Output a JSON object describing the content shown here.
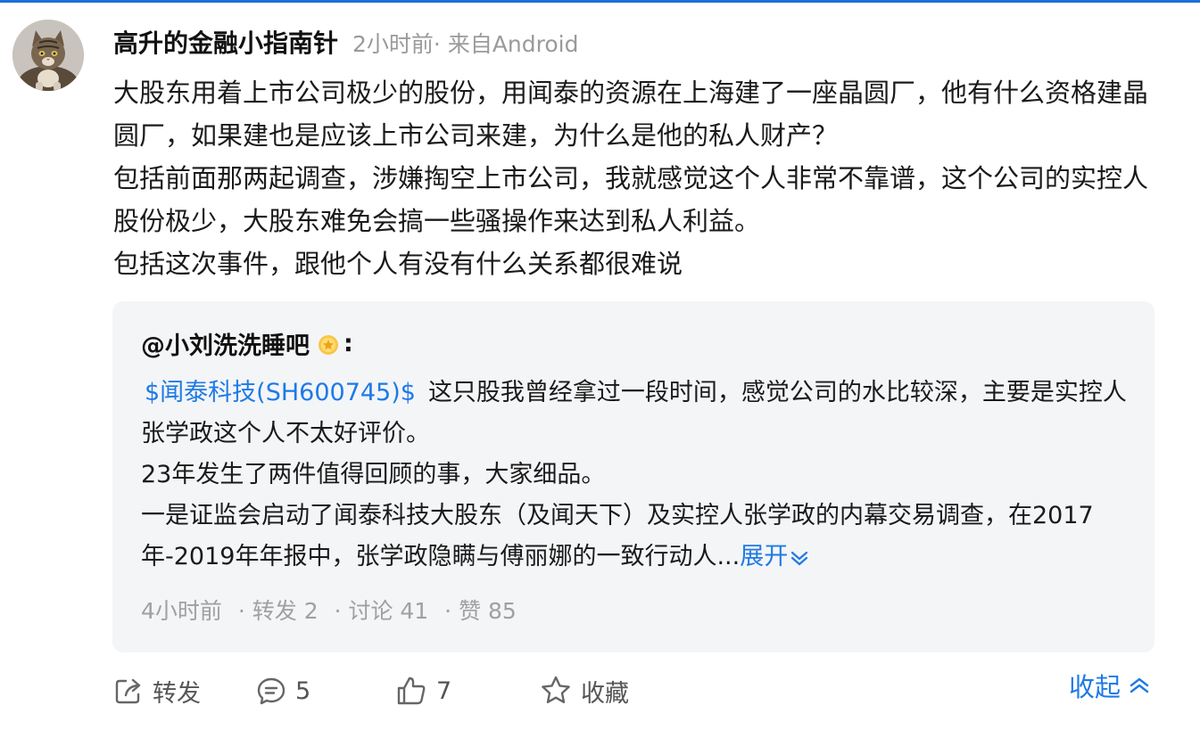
{
  "colors": {
    "accent": "#1e7ae6",
    "text": "#1a1a1a",
    "muted": "#9a9a9a",
    "card_bg": "#f4f5f7"
  },
  "post": {
    "author": "高升的金融小指南针",
    "meta": "2小时前· 来自Android",
    "paragraphs": [
      "大股东用着上市公司极少的股份，用闻泰的资源在上海建了一座晶圆厂，他有什么资格建晶圆厂，如果建也是应该上市公司来建，为什么是他的私人财产？",
      "包括前面那两起调查，涉嫌掏空上市公司，我就感觉这个人非常不靠谱，这个公司的实控人股份极少，大股东难免会搞一些骚操作来达到私人利益。",
      "包括这次事件，跟他个人有没有什么关系都很难说"
    ]
  },
  "quote": {
    "author": "@小刘洗洗睡吧",
    "badge_icon": "gold-medal-icon",
    "colon": ":",
    "stock": "$闻泰科技(SH600745)$",
    "line1": "这只股我曾经拿过一段时间，感觉公司的水比较深，主要是实控人张学政这个人不太好评价。",
    "line2": "23年发生了两件值得回顾的事，大家细品。",
    "line3": "一是证监会启动了闻泰科技大股东（及闻天下）及实控人张学政的内幕交易调查，在2017年-2019年年报中，张学政隐瞒与傅丽娜的一致行动人...",
    "expand": "展开",
    "stats": {
      "time": "4小时前",
      "repost": "· 转发 2",
      "discuss": "· 讨论 41",
      "like": "· 赞 85"
    }
  },
  "actions": {
    "repost": "转发",
    "comment_count": "5",
    "like_count": "7",
    "favorite": "收藏",
    "collapse": "收起"
  },
  "icons": {
    "repost": "share-icon",
    "comment": "comment-icon",
    "like": "thumbs-up-icon",
    "favorite": "star-icon",
    "collapse": "chevron-up-icon",
    "expand": "chevron-down-icon"
  }
}
